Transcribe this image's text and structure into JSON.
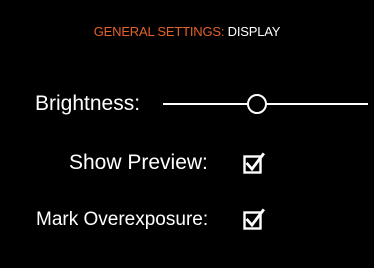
{
  "header": {
    "section": "GENERAL SETTINGS:",
    "page": "DISPLAY"
  },
  "settings": {
    "brightness": {
      "label": "Brightness:",
      "value": 0.46
    },
    "show_preview": {
      "label": "Show Preview:",
      "checked": true
    },
    "mark_overexposure": {
      "label": "Mark Overexposure:",
      "checked": true
    }
  },
  "colors": {
    "background": "#000000",
    "accent": "#e2622b",
    "text": "#ffffff"
  },
  "icons": {
    "checkbox_checked": "checkmark-in-box"
  }
}
